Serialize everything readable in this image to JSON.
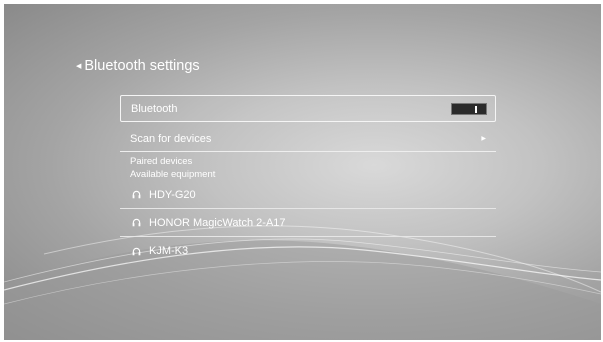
{
  "header": {
    "back_icon": "back-arrow-icon",
    "title": "Bluetooth settings"
  },
  "bluetooth": {
    "label": "Bluetooth",
    "enabled": true
  },
  "scan": {
    "label": "Scan for devices",
    "icon": "chevron-right-icon"
  },
  "paired_label": "Paired devices",
  "available_label": "Available equipment",
  "devices": [
    {
      "name": "HDY-G20",
      "icon": "headphones-icon"
    },
    {
      "name": "HONOR MagicWatch 2-A17",
      "icon": "headphones-icon"
    },
    {
      "name": "KJM-K3",
      "icon": "headphones-icon"
    }
  ],
  "colors": {
    "text": "#ffffff",
    "toggle_track": "#2b2b2b"
  }
}
